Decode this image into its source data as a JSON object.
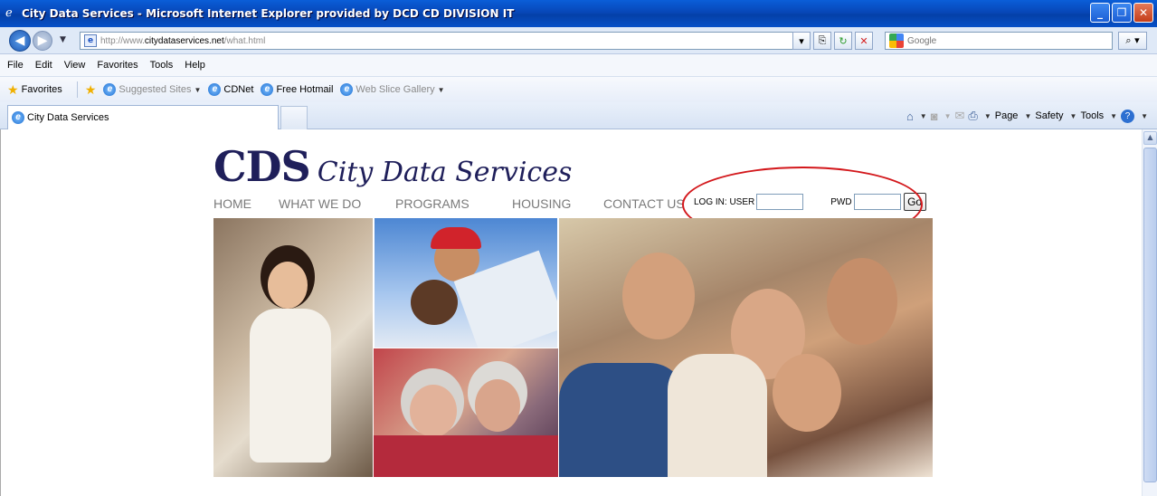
{
  "window": {
    "title": "City Data Services - Microsoft Internet Explorer provided by DCD CD DIVISION IT",
    "controls": [
      "minimize",
      "maximize",
      "close"
    ]
  },
  "address_bar": {
    "url_prefix": "http://www.",
    "url_domain": "citydataservices.net",
    "url_path": "/what.html",
    "search_placeholder": "Google"
  },
  "menu": [
    "File",
    "Edit",
    "View",
    "Favorites",
    "Tools",
    "Help"
  ],
  "favorites_bar": {
    "favorites_label": "Favorites",
    "items": [
      "Suggested Sites",
      "CDNet",
      "Free Hotmail",
      "Web Slice Gallery"
    ]
  },
  "tab": {
    "label": "City Data Services"
  },
  "command_bar": {
    "page": "Page",
    "safety": "Safety",
    "tools": "Tools"
  },
  "site": {
    "logo_abbr": "CDS",
    "logo_name": "City Data Services",
    "nav": [
      "HOME",
      "WHAT WE DO",
      "PROGRAMS",
      "HOUSING",
      "CONTACT US"
    ],
    "login_user_label": "LOG IN: USER",
    "login_pwd_label": "PWD",
    "go_label": "Go"
  },
  "colors": {
    "logo": "#1f1f5a",
    "nav_text": "#7a7a7a",
    "annotation_circle": "#d3181c"
  }
}
